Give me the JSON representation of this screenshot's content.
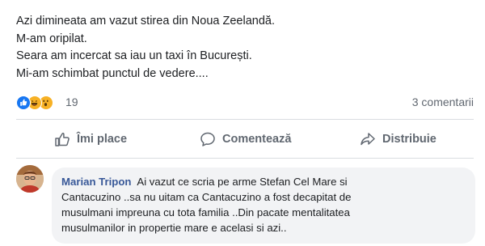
{
  "post": {
    "lines": [
      "Azi dimineata am vazut stirea din Noua Zeelandă.",
      "M-am oripilat.",
      "Seara am incercat sa iau un taxi în București.",
      "Mi-am schimbat punctul de vedere...."
    ]
  },
  "stats": {
    "reaction_icons": [
      "like-icon",
      "haha-icon",
      "wow-icon"
    ],
    "reaction_count": "19",
    "comments_count": "3 comentarii"
  },
  "actions": {
    "like_label": "Îmi place",
    "comment_label": "Comentează",
    "share_label": "Distribuie"
  },
  "colors": {
    "link": "#385898",
    "muted": "#606770",
    "like_blue": "#1877f2",
    "reaction_yellow": "#f7b125",
    "bubble_bg": "#f2f3f5"
  },
  "comment": {
    "author": "Marian Tripon",
    "lines": [
      "Ai vazut ce scria pe arme Stefan Cel Mare si",
      "Cantacuzino ..sa nu uitam ca Cantacuzino a fost decapitat de",
      "musulmani impreuna cu tota familia ..Din pacate mentalitatea",
      "musulmanilor in propertie mare e acelasi si azi.."
    ]
  }
}
